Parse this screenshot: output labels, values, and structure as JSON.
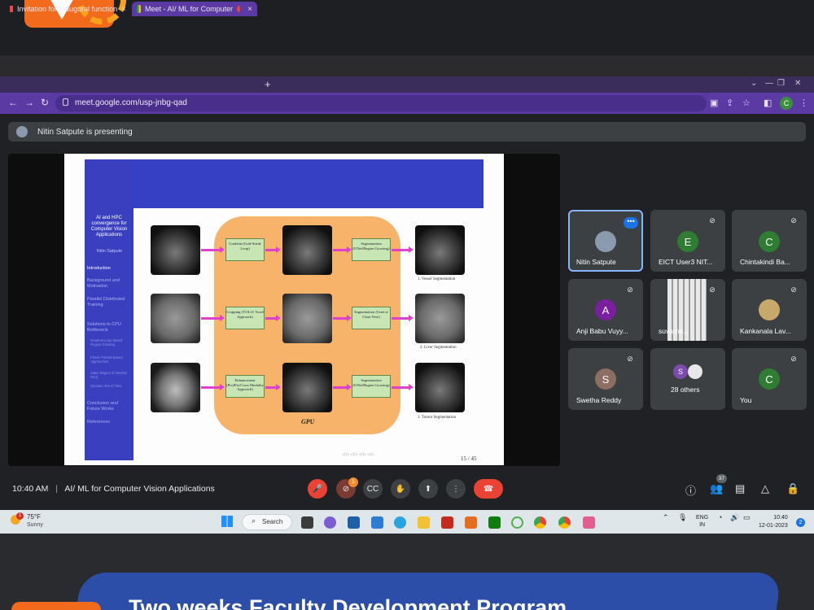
{
  "browser": {
    "tabs": [
      {
        "label": "Invitation for Inaugural function",
        "active": false
      },
      {
        "label": "Meet - AI/ ML for Computer",
        "active": true
      }
    ],
    "url": "meet.google.com/usp-jnbg-qad",
    "profile_initial": "C",
    "colors": {
      "tabbar": "#3a2d5c",
      "toolbar": "#5b3aa3"
    }
  },
  "meet": {
    "presenting_text": "Nitin Satpute is presenting",
    "time": "10:40 AM",
    "meeting_title": "AI/ ML for Computer Vision Applications",
    "participants": [
      {
        "name": "Nitin Satpute",
        "initial": "",
        "color": "#8a9bb0",
        "speaking": true
      },
      {
        "name": "EICT User3 NIT...",
        "initial": "E",
        "color": "#2e7d32"
      },
      {
        "name": "Chintakindi Ba...",
        "initial": "C",
        "color": "#2e7d32"
      },
      {
        "name": "Anji Babu Vuyy...",
        "initial": "A",
        "color": "#7b1fa2"
      },
      {
        "name": "suvarna...",
        "initial": "",
        "color": "#9aa0a6"
      },
      {
        "name": "Kankanala Lav...",
        "initial": "",
        "color": "#c9a86b"
      },
      {
        "name": "Swetha Reddy",
        "initial": "S",
        "color": "#8d6e63"
      },
      {
        "name": "28 others",
        "initial": "S",
        "color": "#7b4bb0"
      },
      {
        "name": "You",
        "initial": "C",
        "color": "#2e7d32"
      }
    ],
    "people_count": "37",
    "notification_count": "1"
  },
  "slide": {
    "sidebar_title": "AI and HPC convergence for Computer Vision Applications",
    "author": "Nitin Satpute",
    "nav": [
      {
        "label": "Introduction",
        "current": true
      },
      {
        "label": "Background and Motivation",
        "current": false
      },
      {
        "label": "Parallel Distributed Training",
        "current": false
      },
      {
        "label": "Solutions to CPU Bottleneck",
        "current": false
      }
    ],
    "subnav": [
      "Gradient Loop based Region Growing",
      "Phase Portrait Based Approaches",
      "Static Region of Interest (RoI)",
      "Dynamic RoI of Tiles"
    ],
    "nav_tail": [
      "Conclusion and Future Works",
      "References"
    ],
    "rows": [
      {
        "process1": "Gradient (Grid-Stride Loop)",
        "process2": "Segmentation (UNet/Region Growing)",
        "caption": "1. Vessel Segmentation"
      },
      {
        "process1": "Cropping (YOLO/ Voxel Approach)",
        "process2": "Segmentation (Unet or Chan-Vese)",
        "caption": "2. Liver Segmentation"
      },
      {
        "process1": "Enhancement (Pix2Pix/Cross Modality Approach)",
        "process2": "Segmentation (UNet/Region Growing)",
        "caption": "3. Tumor Segmentation"
      }
    ],
    "gpu_label": "GPU",
    "page": "15 / 45"
  },
  "taskbar": {
    "temperature": "75°F",
    "weather": "Sunny",
    "weather_badge": "1",
    "search_label": "Search",
    "lang1": "ENG",
    "lang2": "IN",
    "time": "10:40",
    "date": "12-01-2023",
    "notif": "2"
  },
  "banner": {
    "text": "Two weeks Faculty Development Program"
  }
}
